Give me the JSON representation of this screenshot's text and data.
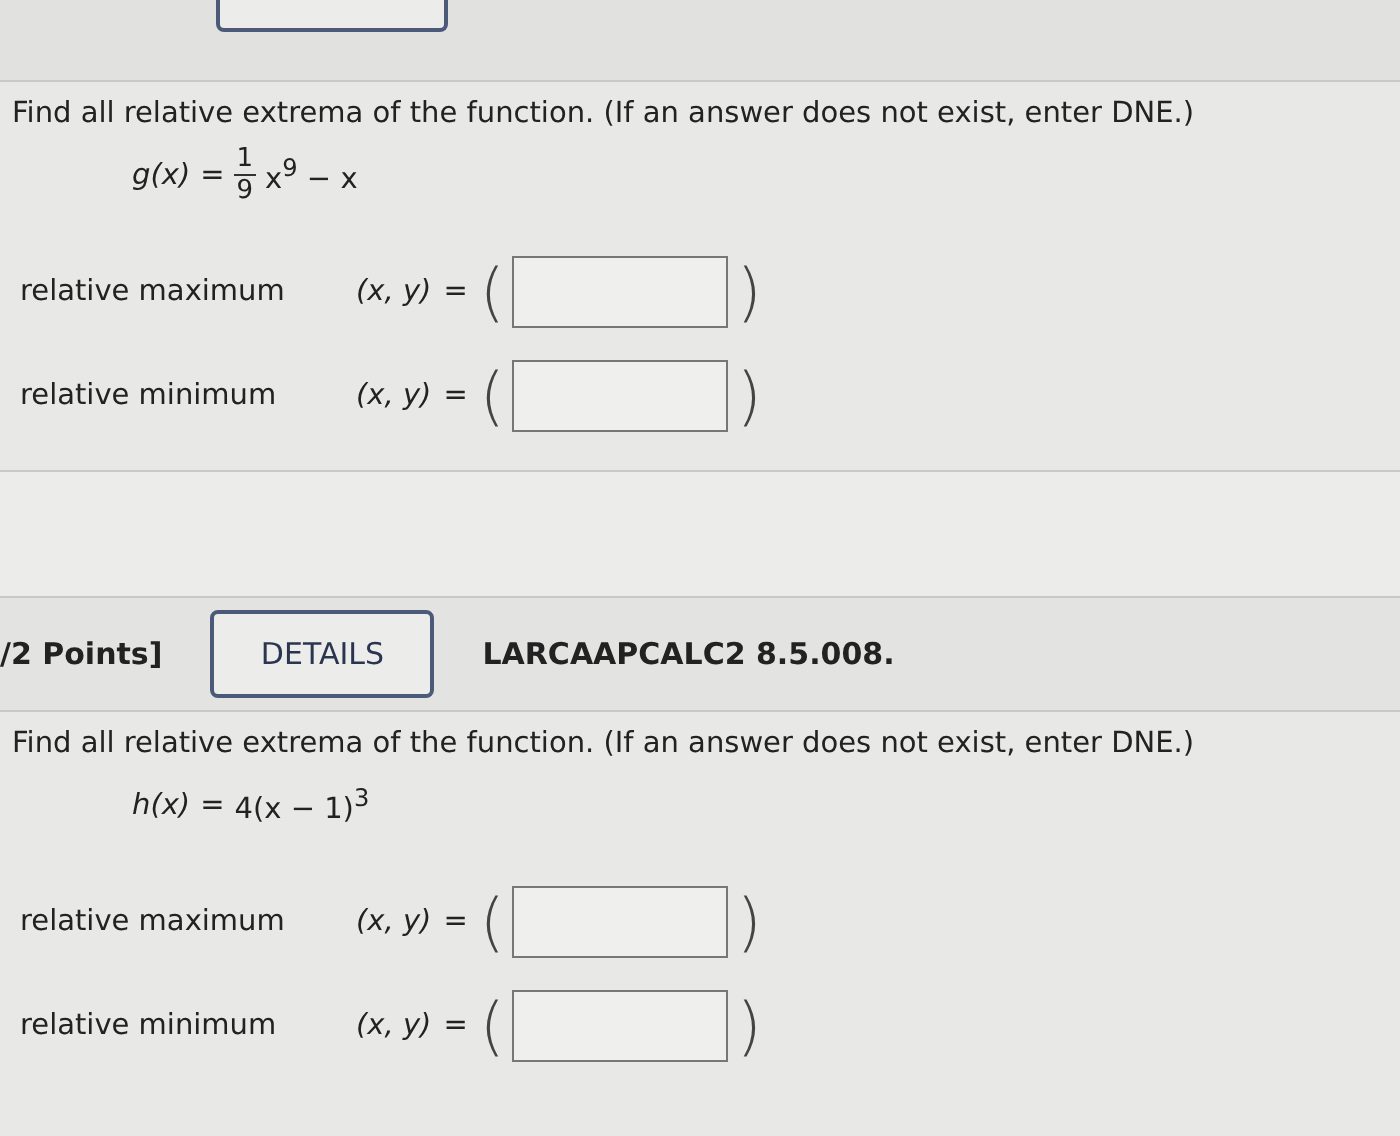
{
  "questions": [
    {
      "prompt": "Find all relative extrema of the function. (If an answer does not exist, enter DNE.)",
      "formula": {
        "kind": "fraction",
        "lhs": "g(x)",
        "eq": "=",
        "numerator": "1",
        "denominator": "9",
        "rest": "x$^{9}$ − x"
      },
      "answers": [
        {
          "label": "relative maximum",
          "pair": "(x, y)",
          "eq": "=",
          "open": "(",
          "close": ")"
        },
        {
          "label": "relative minimum",
          "pair": "(x, y)",
          "eq": "=",
          "open": "(",
          "close": ")"
        }
      ]
    },
    {
      "header": {
        "points": "/2 Points]",
        "details": "DETAILS",
        "code": "LARCAAPCALC2 8.5.008."
      },
      "prompt": "Find all relative extrema of the function. (If an answer does not exist, enter DNE.)",
      "formula": {
        "kind": "plain",
        "lhs": "h(x)",
        "eq": "=",
        "rest": "4(x − 1)$^{3}$"
      },
      "answers": [
        {
          "label": "relative maximum",
          "pair": "(x, y)",
          "eq": "=",
          "open": "(",
          "close": ")"
        },
        {
          "label": "relative minimum",
          "pair": "(x, y)",
          "eq": "=",
          "open": "(",
          "close": ")"
        }
      ]
    }
  ]
}
